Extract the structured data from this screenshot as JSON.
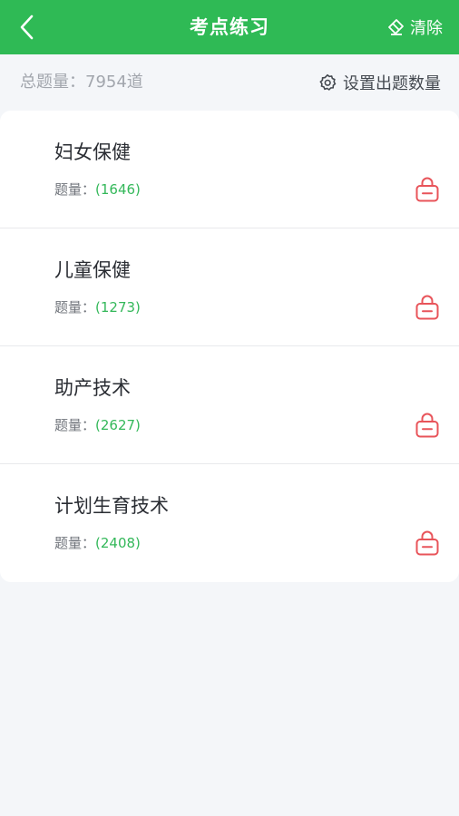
{
  "header": {
    "title": "考点练习",
    "clear_label": "清除"
  },
  "summary": {
    "total_label": "总题量：7954道",
    "settings_label": "设置出题数量"
  },
  "items": [
    {
      "name": "妇女保健",
      "count_label": "题量：",
      "count": "(1646)"
    },
    {
      "name": "儿童保健",
      "count_label": "题量：",
      "count": "(1273)"
    },
    {
      "name": "助产技术",
      "count_label": "题量：",
      "count": "(2627)"
    },
    {
      "name": "计划生育技术",
      "count_label": "题量：",
      "count": "(2408)"
    }
  ],
  "colors": {
    "header_bg": "#2fba55",
    "count_green": "#34b85a",
    "lock_red": "#e8545a",
    "page_bg": "#f4f6f9"
  },
  "icons": {
    "back": "chevron-left-icon",
    "clear": "eraser-icon",
    "settings": "gear-icon",
    "lock": "lock-icon"
  }
}
